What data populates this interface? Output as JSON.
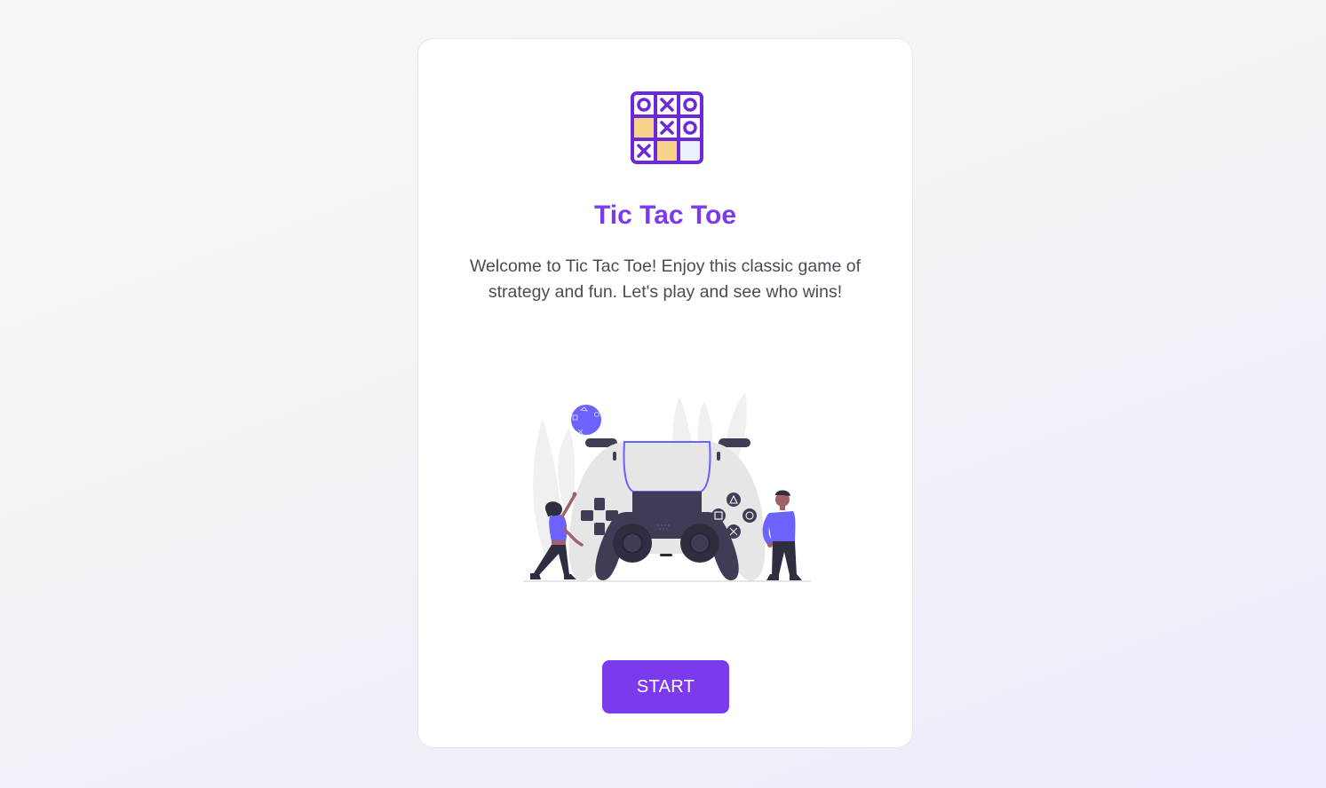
{
  "app": {
    "title": "Tic Tac Toe",
    "description": "Welcome to Tic Tac Toe! Enjoy this classic game of strategy and fun. Let's play and see who wins!",
    "start_label": "START"
  },
  "logo": {
    "icon": "tic-tac-toe-grid-icon",
    "cells": [
      "O",
      "X",
      "O",
      "",
      "X",
      "O",
      "X",
      "",
      ""
    ]
  },
  "illustration": {
    "icon": "game-controller-players-illustration"
  },
  "colors": {
    "accent": "#7c3aed",
    "text": "#4b4b55",
    "card": "#ffffff",
    "illustration_purple": "#6c63ff",
    "illustration_dark": "#3f3d56",
    "cell_yellow": "#f8d48a",
    "cell_light": "#e9f1fb"
  }
}
